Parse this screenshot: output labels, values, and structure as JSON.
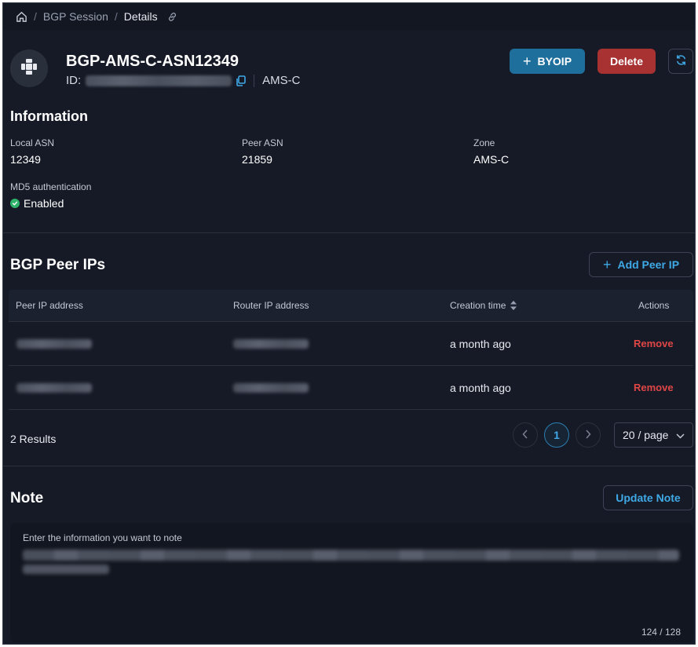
{
  "breadcrumb": {
    "home_icon": "home-icon",
    "items": [
      "BGP Session",
      "Details"
    ],
    "separator": "/",
    "link_icon": "link-icon"
  },
  "header": {
    "title": "BGP-AMS-C-ASN12349",
    "id_label": "ID:",
    "zone": "AMS-C",
    "byoip_label": "BYOIP",
    "delete_label": "Delete"
  },
  "information": {
    "heading": "Information",
    "local_asn_label": "Local ASN",
    "local_asn_value": "12349",
    "peer_asn_label": "Peer ASN",
    "peer_asn_value": "21859",
    "zone_label": "Zone",
    "zone_value": "AMS-C",
    "md5_label": "MD5 authentication",
    "md5_value": "Enabled"
  },
  "peer_ips": {
    "heading": "BGP Peer IPs",
    "add_label": "Add Peer IP",
    "columns": [
      "Peer IP address",
      "Router IP address",
      "Creation time",
      "Actions"
    ],
    "rows": [
      {
        "creation": "a month ago",
        "action": "Remove"
      },
      {
        "creation": "a month ago",
        "action": "Remove"
      }
    ],
    "results": "2 Results",
    "page": "1",
    "page_size": "20 / page"
  },
  "note": {
    "heading": "Note",
    "update_label": "Update Note",
    "placeholder": "Enter the information you want to note",
    "counter": "124 / 128"
  },
  "colors": {
    "background": "#161a26",
    "primary": "#1f6f9d",
    "danger": "#a83131",
    "accent_text": "#3fa9e6",
    "remove_text": "#e04646",
    "success": "#2fb36b"
  }
}
